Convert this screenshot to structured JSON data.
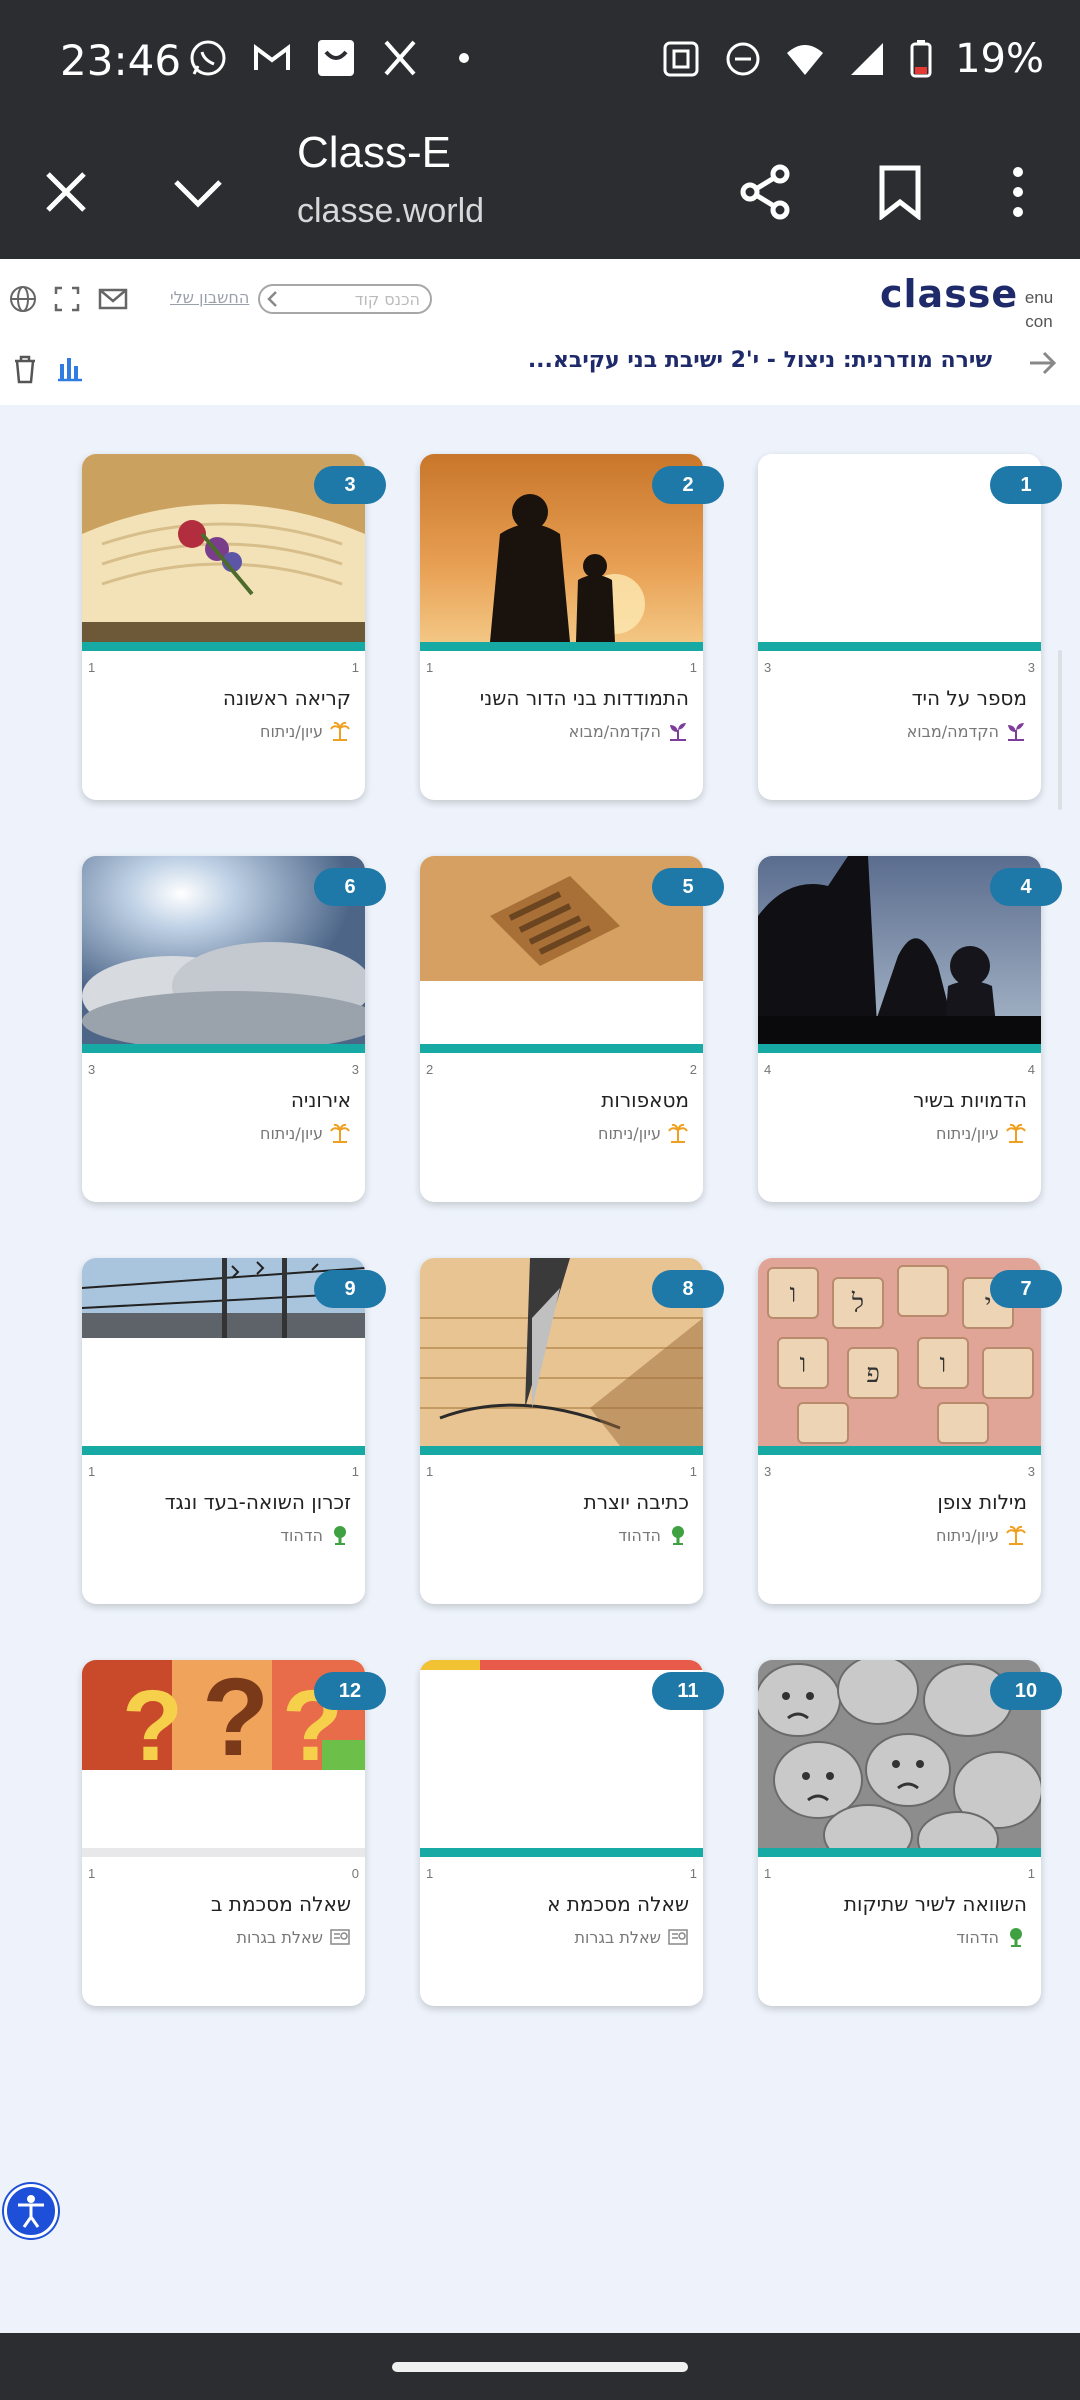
{
  "status_bar": {
    "time": "23:46",
    "battery_text": "19%",
    "left_icons": [
      "whatsapp-icon",
      "gmail-icon",
      "box-icon",
      "x-icon",
      "dot-icon"
    ],
    "right_icons": [
      "nfc-icon",
      "dnd-icon",
      "wifi-icon",
      "signal-icon",
      "battery-icon"
    ]
  },
  "browser": {
    "title": "Class-E",
    "url": "classe.world"
  },
  "header": {
    "logo": "classe",
    "menu_alt_text": "enu con",
    "code_placeholder": "הכנס קוד",
    "my_account": "החשבון שלי",
    "course_title": "שירה מודרנית: ניצול - י'2 ישיבת בני עקיבא..."
  },
  "colors": {
    "accent_teal": "#17a9a3",
    "badge_blue": "#1e78a8",
    "brand_navy": "#1f2a6b"
  },
  "cards": [
    {
      "number": "1",
      "title": "מספר על היד",
      "category": "הקדמה/מבוא",
      "cat_icon": "sprout-icon",
      "left": "3",
      "right": "3",
      "image": "blank"
    },
    {
      "number": "2",
      "title": "התמודדות בני הדור השני",
      "category": "הקדמה/מבוא",
      "cat_icon": "sprout-icon",
      "left": "1",
      "right": "1",
      "image": "silhouette"
    },
    {
      "number": "3",
      "title": "קריאה ראשונה",
      "category": "עיון/ניתוח",
      "cat_icon": "palm-icon",
      "left": "1",
      "right": "1",
      "image": "book-flowers"
    },
    {
      "number": "4",
      "title": "הדמויות בשיר",
      "category": "עיון/ניתוח",
      "cat_icon": "palm-icon",
      "left": "4",
      "right": "4",
      "image": "dark-figures"
    },
    {
      "number": "5",
      "title": "מטאפורות",
      "category": "עיון/ניתוח",
      "cat_icon": "palm-icon",
      "left": "2",
      "right": "2",
      "image": "sand"
    },
    {
      "number": "6",
      "title": "אירוניה",
      "category": "עיון/ניתוח",
      "cat_icon": "palm-icon",
      "left": "3",
      "right": "3",
      "image": "clouds"
    },
    {
      "number": "7",
      "title": "מילות צופן",
      "category": "עיון/ניתוח",
      "cat_icon": "palm-icon",
      "left": "3",
      "right": "3",
      "image": "letter-tiles"
    },
    {
      "number": "8",
      "title": "כתיבה יוצרת",
      "category": "הדהוד",
      "cat_icon": "tree-icon",
      "left": "1",
      "right": "1",
      "image": "pen"
    },
    {
      "number": "9",
      "title": "זכרון השואה-בעד ונגד",
      "category": "הדהוד",
      "cat_icon": "tree-icon",
      "left": "1",
      "right": "1",
      "image": "barbed-wire"
    },
    {
      "number": "10",
      "title": "השוואה לשיר שתיקות",
      "category": "הדהוד",
      "cat_icon": "tree-icon",
      "left": "1",
      "right": "1",
      "image": "masks"
    },
    {
      "number": "11",
      "title": "שאלה מסכמת א",
      "category": "שאלת בגרות",
      "cat_icon": "exam-icon",
      "left": "1",
      "right": "1",
      "image": "blank-colorful"
    },
    {
      "number": "12",
      "title": "שאלה מסכמת ב",
      "category": "שאלת בגרות",
      "cat_icon": "exam-icon",
      "left": "1",
      "right": "0",
      "image": "question-marks",
      "bar": "gray"
    }
  ]
}
